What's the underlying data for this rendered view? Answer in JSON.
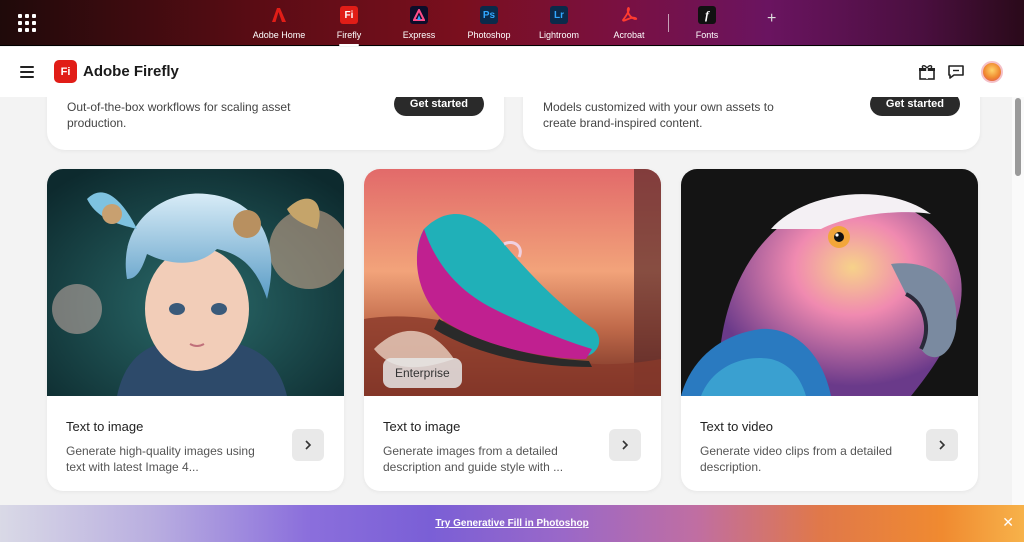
{
  "appbar": {
    "apps": [
      {
        "name": "Adobe Home",
        "glyph": "A",
        "color": "#e11d17",
        "active": false
      },
      {
        "name": "Firefly",
        "glyph": "Fi",
        "color": "#e11d17",
        "active": true
      },
      {
        "name": "Express",
        "glyph": "A",
        "color": "#0d0d2a",
        "active": false
      },
      {
        "name": "Photoshop",
        "glyph": "Ps",
        "color": "#0b2a4a",
        "active": false
      },
      {
        "name": "Lightroom",
        "glyph": "Lr",
        "color": "#0b2a4a",
        "active": false
      },
      {
        "name": "Acrobat",
        "glyph": "A",
        "color": "#e11d17",
        "active": false
      },
      {
        "name": "Fonts",
        "glyph": "f",
        "color": "#111111",
        "active": false
      }
    ]
  },
  "header": {
    "logo_text": "Fi",
    "brand": "Adobe Firefly"
  },
  "top_cards": [
    {
      "text": "Out-of-the-box workflows for scaling asset production.",
      "button": "Get started"
    },
    {
      "text": "Models customized with your own assets to create brand-inspired content.",
      "button": "Get started"
    }
  ],
  "cards": [
    {
      "title": "Text to image",
      "desc": "Generate high-quality images using text with latest Image 4...",
      "badge": ""
    },
    {
      "title": "Text to image",
      "desc": "Generate images from a detailed description and guide style with ...",
      "badge": "Enterprise"
    },
    {
      "title": "Text to video",
      "desc": "Generate video clips from a detailed description.",
      "badge": ""
    }
  ],
  "promo": {
    "link": "Try Generative Fill in Photoshop"
  }
}
